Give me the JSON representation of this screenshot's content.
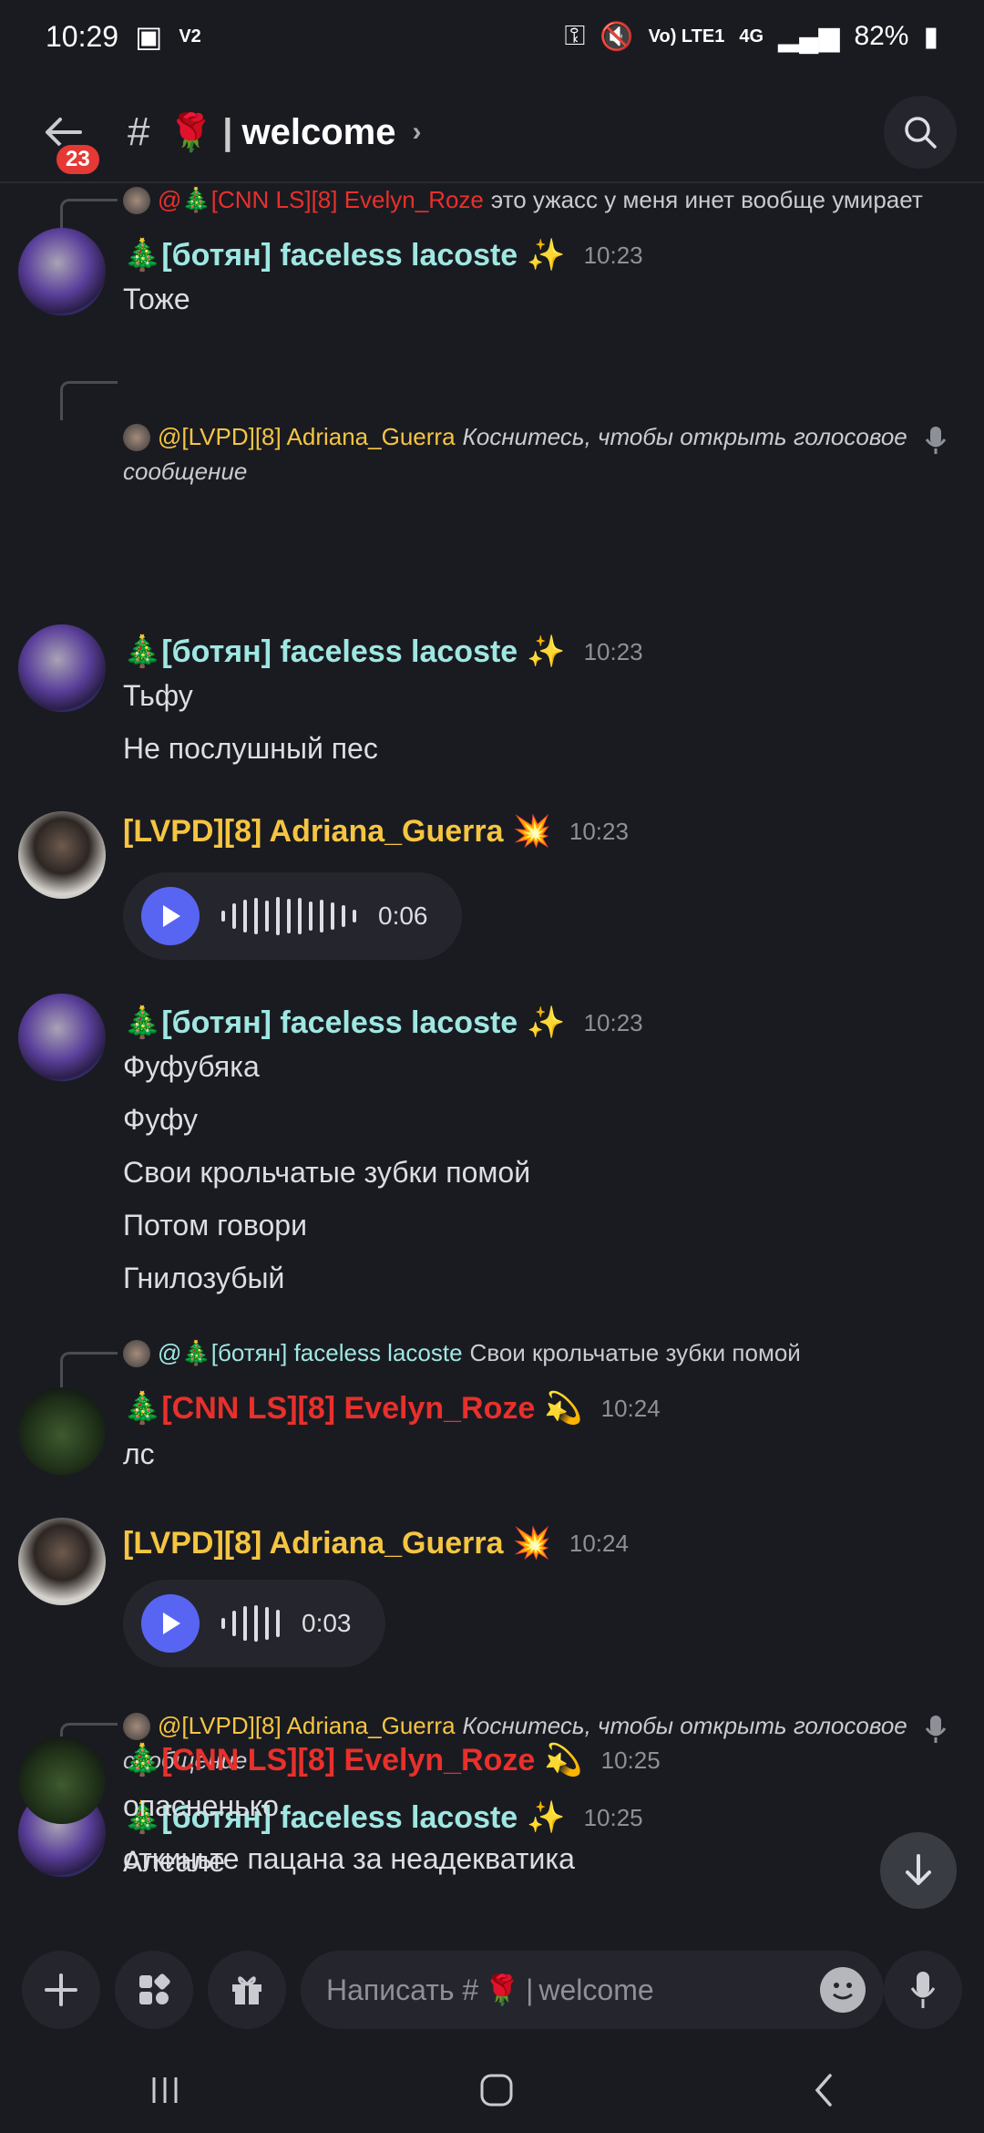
{
  "status": {
    "time": "10:29",
    "v2": "V2",
    "battery": "82%",
    "volte": "Vo) LTE1",
    "net": "4G"
  },
  "header": {
    "badge": "23",
    "channel_emoji": "🌹",
    "channel": "welcome"
  },
  "messages": {
    "m1": {
      "reply_user": "@🎄[CNN LS][8] Evelyn_Roze",
      "reply_text": "это ужасс у меня инет вообще умирает",
      "user": "🎄[ботян] faceless lacoste",
      "badge": "✨",
      "time": "10:23",
      "lines": [
        "Тоже"
      ]
    },
    "m2": {
      "reply_user": "@[LVPD][8] Adriana_Guerra",
      "reply_text": "Коснитесь, чтобы открыть голосовое",
      "reply_text2": "сообщение",
      "user": "🎄[ботян] faceless lacoste",
      "badge": "✨",
      "time": "10:23",
      "lines": [
        "Тьфу",
        "Не послушный пес"
      ]
    },
    "m3": {
      "user": "[LVPD][8] Adriana_Guerra",
      "badge": "💥",
      "time": "10:23",
      "duration": "0:06"
    },
    "m4": {
      "user": "🎄[ботян] faceless lacoste",
      "badge": "✨",
      "time": "10:23",
      "lines": [
        "Фуфубяка",
        "Фуфу",
        "Свои крольчатые зубки помой",
        "Потом говори",
        "Гнилозубый"
      ]
    },
    "m5": {
      "reply_user": "@🎄[ботян] faceless lacoste",
      "reply_text": "Свои крольчатые зубки помой",
      "user": "🎄[CNN LS][8] Evelyn_Roze",
      "badge": "💫",
      "time": "10:24",
      "lines": [
        "лс"
      ]
    },
    "m6": {
      "user": "[LVPD][8] Adriana_Guerra",
      "badge": "💥",
      "time": "10:24",
      "duration": "0:03"
    },
    "m7": {
      "reply_user": "@[LVPD][8] Adriana_Guerra",
      "reply_text": "Коснитесь, чтобы открыть голосовое",
      "reply_text2": "сообщение",
      "user": "🎄[ботян] faceless lacoste",
      "badge": "✨",
      "time": "10:25",
      "lines": [
        "Алеале"
      ]
    },
    "m8": {
      "user": "🎄[CNN LS][8] Evelyn_Roze",
      "badge": "💫",
      "time": "10:25",
      "lines": [
        "опасненько",
        "откиньте пацана за неадекватика"
      ]
    }
  },
  "composer": {
    "placeholder_prefix": "Написать #",
    "placeholder_emoji": "🌹",
    "placeholder_channel": "welcome"
  }
}
